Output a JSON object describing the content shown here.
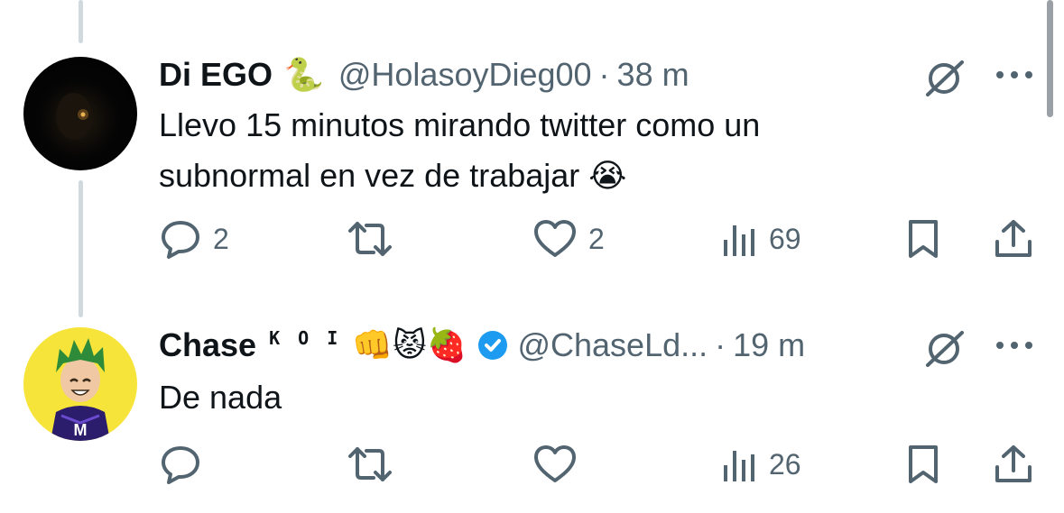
{
  "colors": {
    "text": "#0f1419",
    "secondary": "#536471",
    "verified": "#1d9bf0",
    "thread_line": "#cfd9de"
  },
  "tweets": [
    {
      "display_name": "Di EGO",
      "name_emoji": "🐍",
      "handle": "@HolasoyDieg00",
      "separator": "·",
      "time": "38 m",
      "text_line1": "Llevo 15 minutos mirando twitter como un",
      "text_line2": "subnormal en vez de trabajar",
      "text_emoji": "😭",
      "replies": "2",
      "retweets": "",
      "likes": "2",
      "views": "69",
      "icons": [
        "reply-icon",
        "retweet-icon",
        "like-icon",
        "views-icon",
        "bookmark-icon",
        "share-icon",
        "grok-icon",
        "more-icon"
      ]
    },
    {
      "display_name": "Chase",
      "name_badge": "K O I",
      "name_emojis": "👊😾🍓",
      "verified": true,
      "handle": "@ChaseLd...",
      "separator": "·",
      "time": "19 m",
      "text_line1": "De nada",
      "replies": "",
      "retweets": "",
      "likes": "",
      "views": "26",
      "icons": [
        "reply-icon",
        "retweet-icon",
        "like-icon",
        "views-icon",
        "bookmark-icon",
        "share-icon",
        "grok-icon",
        "more-icon",
        "verified-icon"
      ]
    }
  ]
}
